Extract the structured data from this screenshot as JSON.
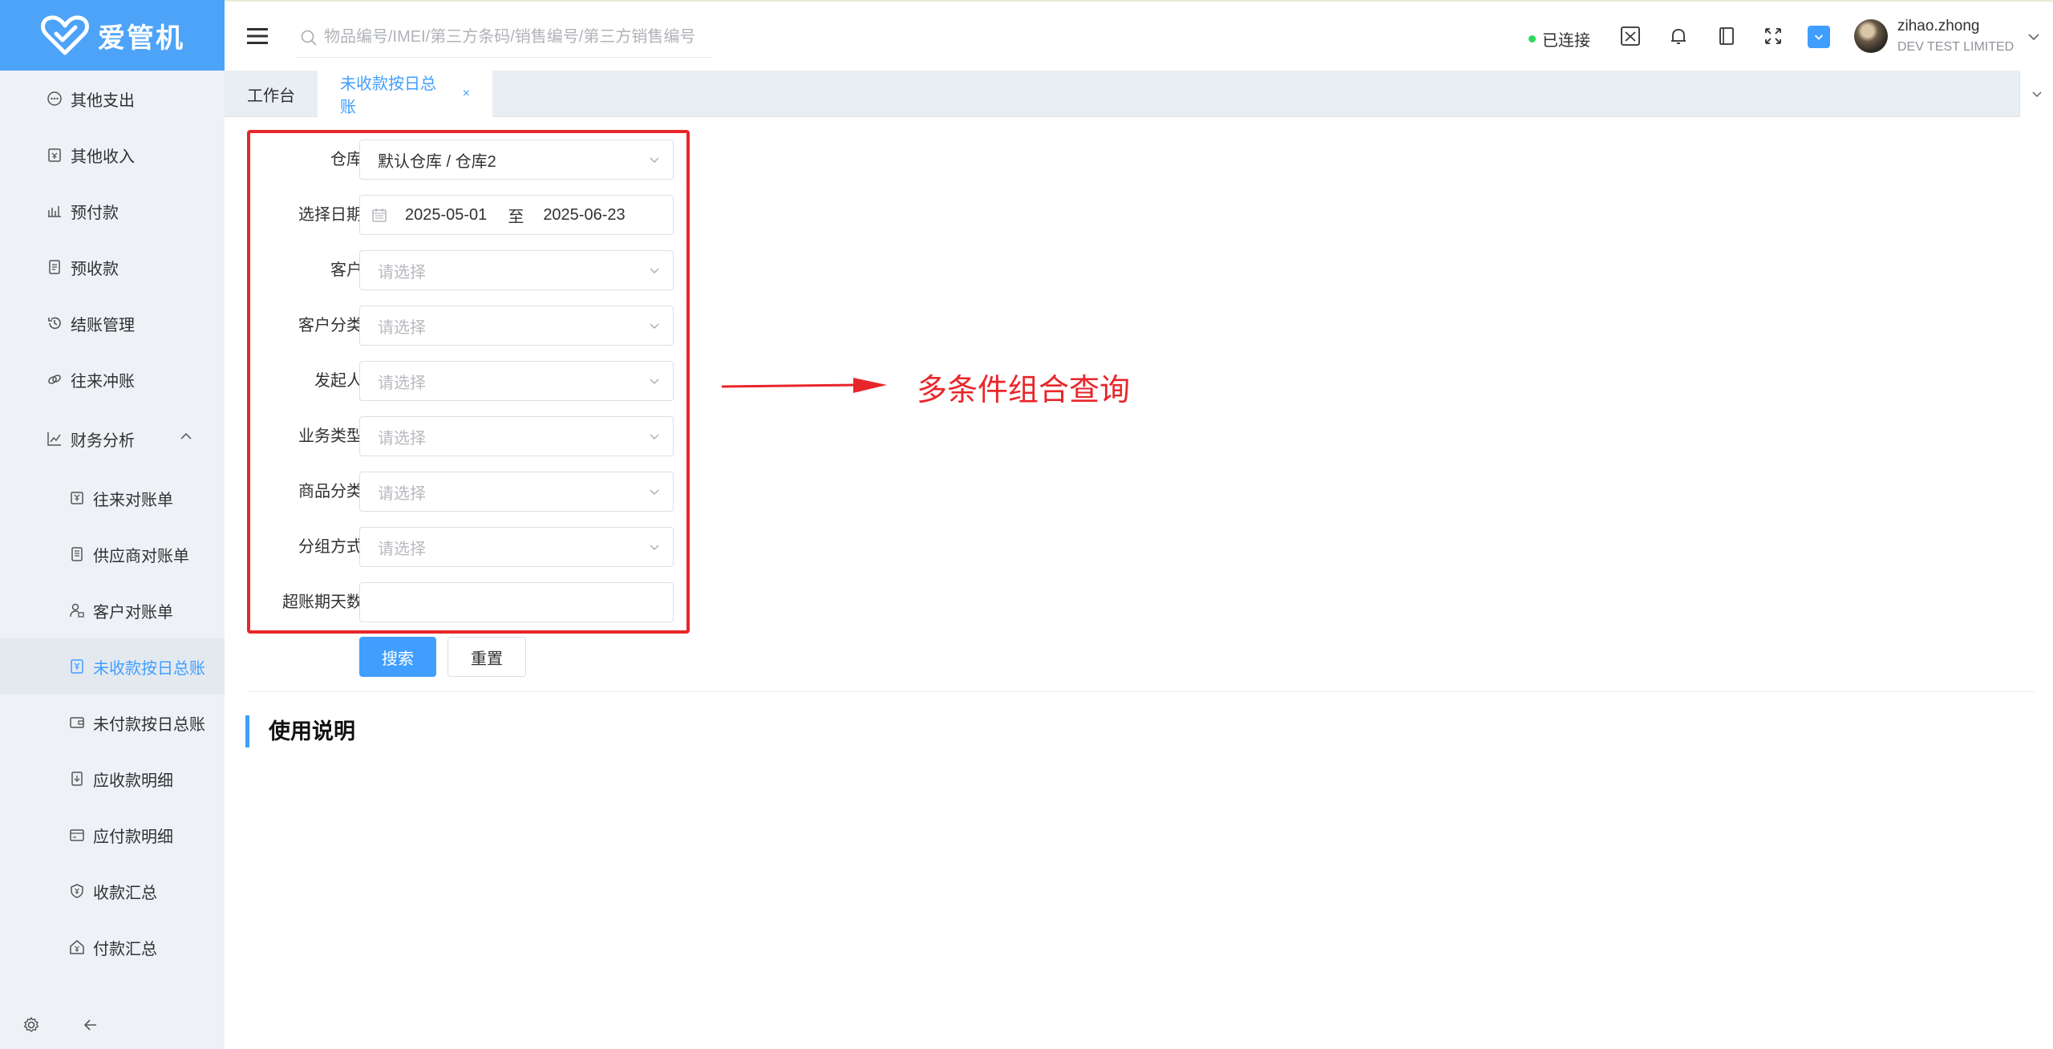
{
  "app": {
    "logo_text": "爱管机"
  },
  "sidebar": {
    "items": [
      {
        "label": "其他支出",
        "icon": "ellipsis-circle-icon"
      },
      {
        "label": "其他收入",
        "icon": "calendar-yen-icon"
      },
      {
        "label": "预付款",
        "icon": "chart-doc-icon"
      },
      {
        "label": "预收款",
        "icon": "receipt-icon"
      },
      {
        "label": "结账管理",
        "icon": "history-icon"
      },
      {
        "label": "往来冲账",
        "icon": "link-icon"
      }
    ],
    "group": {
      "label": "财务分析",
      "icon": "chart-icon",
      "expanded": true
    },
    "sub_items": [
      {
        "label": "往来对账单",
        "icon": "yen-doc-icon"
      },
      {
        "label": "供应商对账单",
        "icon": "list-doc-icon"
      },
      {
        "label": "客户对账单",
        "icon": "user-lock-icon"
      },
      {
        "label": "未收款按日总账",
        "icon": "yen-doc-icon",
        "active": true
      },
      {
        "label": "未付款按日总账",
        "icon": "wallet-icon"
      },
      {
        "label": "应收款明细",
        "icon": "doc-arrow-icon"
      },
      {
        "label": "应付款明细",
        "icon": "card-icon"
      },
      {
        "label": "收款汇总",
        "icon": "shield-yen-icon"
      },
      {
        "label": "付款汇总",
        "icon": "home-yen-icon"
      }
    ]
  },
  "header": {
    "search_placeholder": "物品编号/IMEI/第三方条码/销售编号/第三方销售编号",
    "connection_status": "已连接",
    "user_name": "zihao.zhong",
    "user_org": "DEV TEST LIMITED"
  },
  "tabs": [
    {
      "label": "工作台",
      "active": false
    },
    {
      "label": "未收款按日总账",
      "active": true,
      "close": "×"
    }
  ],
  "form": {
    "fields": [
      {
        "label": "仓库",
        "value": "默认仓库 / 仓库2",
        "placeholder": ""
      },
      {
        "label": "选择日期",
        "start": "2025-05-01",
        "sep": "至",
        "end": "2025-06-23"
      },
      {
        "label": "客户",
        "placeholder": "请选择"
      },
      {
        "label": "客户分类",
        "placeholder": "请选择"
      },
      {
        "label": "发起人",
        "placeholder": "请选择"
      },
      {
        "label": "业务类型",
        "placeholder": "请选择"
      },
      {
        "label": "商品分类",
        "placeholder": "请选择"
      },
      {
        "label": "分组方式",
        "placeholder": "请选择"
      },
      {
        "label": "超账期天数",
        "placeholder": ""
      }
    ],
    "search_button": "搜索",
    "reset_button": "重置"
  },
  "usage_title": "使用说明",
  "annotation": {
    "text": "多条件组合查询",
    "color": "#e8262a"
  },
  "colors": {
    "primary": "#409eff",
    "logo_bg": "#4da3f7",
    "sidebar_bg": "#eef1f6",
    "annotation": "#e8262a"
  }
}
